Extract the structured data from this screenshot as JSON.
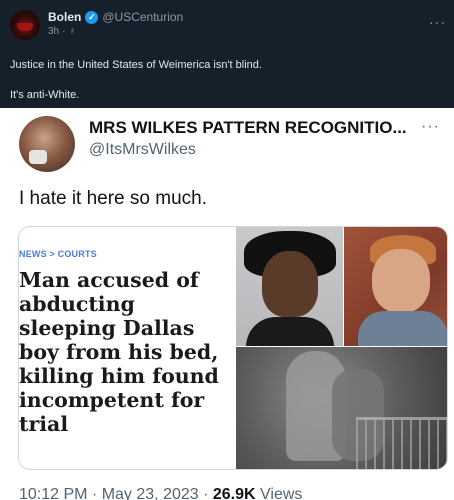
{
  "outer_post": {
    "display_name": "Bolen",
    "handle": "@USCenturion",
    "time": "3h",
    "time_separator": "·",
    "more_icon": "···",
    "text_lines": [
      "Justice in the United States of Weimerica isn't blind.",
      "It's anti-White."
    ]
  },
  "embedded_tweet": {
    "display_name": "MRS WILKES PATTERN RECOGNITIO...",
    "handle": "@ItsMrsWilkes",
    "more_icon": "···",
    "text": "I hate it here so much.",
    "article": {
      "category": "NEWS > COURTS",
      "headline": "Man accused of abducting sleeping Dallas boy from his bed, killing him found incompetent for trial"
    },
    "footer": {
      "timestamp": "10:12 PM · May 23, 2023 · ",
      "views_count": "26.9K",
      "views_label": " Views"
    }
  },
  "colors": {
    "dark_bg": "#15202b",
    "verified_blue": "#1d9bf0",
    "category_blue": "#4a7bd0"
  }
}
